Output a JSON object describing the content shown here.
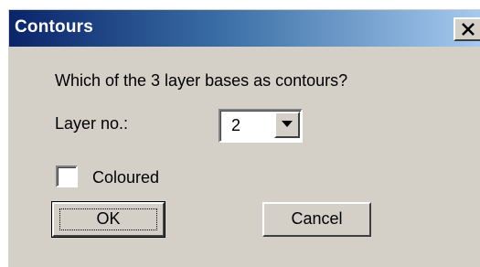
{
  "window": {
    "title": "Contours"
  },
  "dialog": {
    "prompt": "Which of the 3 layer bases as contours?",
    "layer_label": "Layer no.:",
    "layer_value": "2",
    "coloured_label": "Coloured",
    "coloured_checked": false,
    "ok_label": "OK",
    "cancel_label": "Cancel"
  },
  "icons": {
    "close": "close-icon",
    "dropdown": "chevron-down-icon"
  },
  "colors": {
    "titlebar_start": "#0a246a",
    "titlebar_end": "#a6caf0",
    "dialog_bg": "#d4d0c8"
  }
}
